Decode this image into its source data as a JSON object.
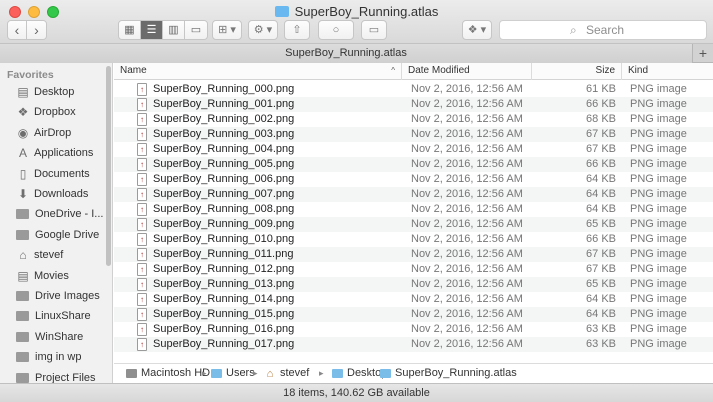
{
  "window": {
    "title": "SuperBoy_Running.atlas",
    "tab_label": "SuperBoy_Running.atlas",
    "tab_add": "+"
  },
  "toolbar": {
    "back": "‹",
    "forward": "›",
    "view_icon": "▦",
    "view_list": "☰",
    "view_columns": "▥",
    "view_coverflow": "▭",
    "arrange": "⊞ ▾",
    "action": "⚙ ▾",
    "share": "⇧",
    "tags": "○",
    "new_folder": "▭",
    "dropbox": "❖ ▾",
    "search_placeholder": "Search",
    "search_icon": "⌕"
  },
  "sidebar": {
    "heading": "Favorites",
    "items": [
      {
        "label": "Desktop",
        "icon": "desktop-icon",
        "glyph": "▤"
      },
      {
        "label": "Dropbox",
        "icon": "dropbox-icon",
        "glyph": "❖"
      },
      {
        "label": "AirDrop",
        "icon": "airdrop-icon",
        "glyph": "◉"
      },
      {
        "label": "Applications",
        "icon": "applications-icon",
        "glyph": "A"
      },
      {
        "label": "Documents",
        "icon": "documents-icon",
        "glyph": "▯"
      },
      {
        "label": "Downloads",
        "icon": "downloads-icon",
        "glyph": "⬇"
      },
      {
        "label": "OneDrive - I...",
        "icon": "folder-icon",
        "glyph": ""
      },
      {
        "label": "Google Drive",
        "icon": "folder-icon",
        "glyph": ""
      },
      {
        "label": "stevef",
        "icon": "home-icon",
        "glyph": "⌂"
      },
      {
        "label": "Movies",
        "icon": "movies-icon",
        "glyph": "▤"
      },
      {
        "label": "Drive Images",
        "icon": "folder-icon",
        "glyph": ""
      },
      {
        "label": "LinuxShare",
        "icon": "folder-icon",
        "glyph": ""
      },
      {
        "label": "WinShare",
        "icon": "folder-icon",
        "glyph": ""
      },
      {
        "label": "img in wp",
        "icon": "folder-icon",
        "glyph": ""
      },
      {
        "label": "Project Files",
        "icon": "folder-icon",
        "glyph": ""
      }
    ]
  },
  "columns": {
    "name": "Name",
    "date": "Date Modified",
    "size": "Size",
    "kind": "Kind",
    "sort_indicator": "^"
  },
  "files": [
    {
      "name": "SuperBoy_Running_000.png",
      "date": "Nov 2, 2016, 12:56 AM",
      "size": "61 KB",
      "kind": "PNG image"
    },
    {
      "name": "SuperBoy_Running_001.png",
      "date": "Nov 2, 2016, 12:56 AM",
      "size": "66 KB",
      "kind": "PNG image"
    },
    {
      "name": "SuperBoy_Running_002.png",
      "date": "Nov 2, 2016, 12:56 AM",
      "size": "68 KB",
      "kind": "PNG image"
    },
    {
      "name": "SuperBoy_Running_003.png",
      "date": "Nov 2, 2016, 12:56 AM",
      "size": "67 KB",
      "kind": "PNG image"
    },
    {
      "name": "SuperBoy_Running_004.png",
      "date": "Nov 2, 2016, 12:56 AM",
      "size": "67 KB",
      "kind": "PNG image"
    },
    {
      "name": "SuperBoy_Running_005.png",
      "date": "Nov 2, 2016, 12:56 AM",
      "size": "66 KB",
      "kind": "PNG image"
    },
    {
      "name": "SuperBoy_Running_006.png",
      "date": "Nov 2, 2016, 12:56 AM",
      "size": "64 KB",
      "kind": "PNG image"
    },
    {
      "name": "SuperBoy_Running_007.png",
      "date": "Nov 2, 2016, 12:56 AM",
      "size": "64 KB",
      "kind": "PNG image"
    },
    {
      "name": "SuperBoy_Running_008.png",
      "date": "Nov 2, 2016, 12:56 AM",
      "size": "64 KB",
      "kind": "PNG image"
    },
    {
      "name": "SuperBoy_Running_009.png",
      "date": "Nov 2, 2016, 12:56 AM",
      "size": "65 KB",
      "kind": "PNG image"
    },
    {
      "name": "SuperBoy_Running_010.png",
      "date": "Nov 2, 2016, 12:56 AM",
      "size": "66 KB",
      "kind": "PNG image"
    },
    {
      "name": "SuperBoy_Running_011.png",
      "date": "Nov 2, 2016, 12:56 AM",
      "size": "67 KB",
      "kind": "PNG image"
    },
    {
      "name": "SuperBoy_Running_012.png",
      "date": "Nov 2, 2016, 12:56 AM",
      "size": "67 KB",
      "kind": "PNG image"
    },
    {
      "name": "SuperBoy_Running_013.png",
      "date": "Nov 2, 2016, 12:56 AM",
      "size": "65 KB",
      "kind": "PNG image"
    },
    {
      "name": "SuperBoy_Running_014.png",
      "date": "Nov 2, 2016, 12:56 AM",
      "size": "64 KB",
      "kind": "PNG image"
    },
    {
      "name": "SuperBoy_Running_015.png",
      "date": "Nov 2, 2016, 12:56 AM",
      "size": "64 KB",
      "kind": "PNG image"
    },
    {
      "name": "SuperBoy_Running_016.png",
      "date": "Nov 2, 2016, 12:56 AM",
      "size": "63 KB",
      "kind": "PNG image"
    },
    {
      "name": "SuperBoy_Running_017.png",
      "date": "Nov 2, 2016, 12:56 AM",
      "size": "63 KB",
      "kind": "PNG image"
    }
  ],
  "pathbar": {
    "items": [
      "Macintosh HD",
      "Users",
      "stevef",
      "Desktop",
      "SuperBoy_Running.atlas"
    ],
    "separator": "▸"
  },
  "status": "18 items, 140.62 GB available",
  "colors": {
    "close": "#fc605c",
    "minimize": "#fdbc40",
    "maximize": "#34c84a",
    "folder_blue": "#6ab8f0",
    "row_alt": "#f4f5f5"
  }
}
